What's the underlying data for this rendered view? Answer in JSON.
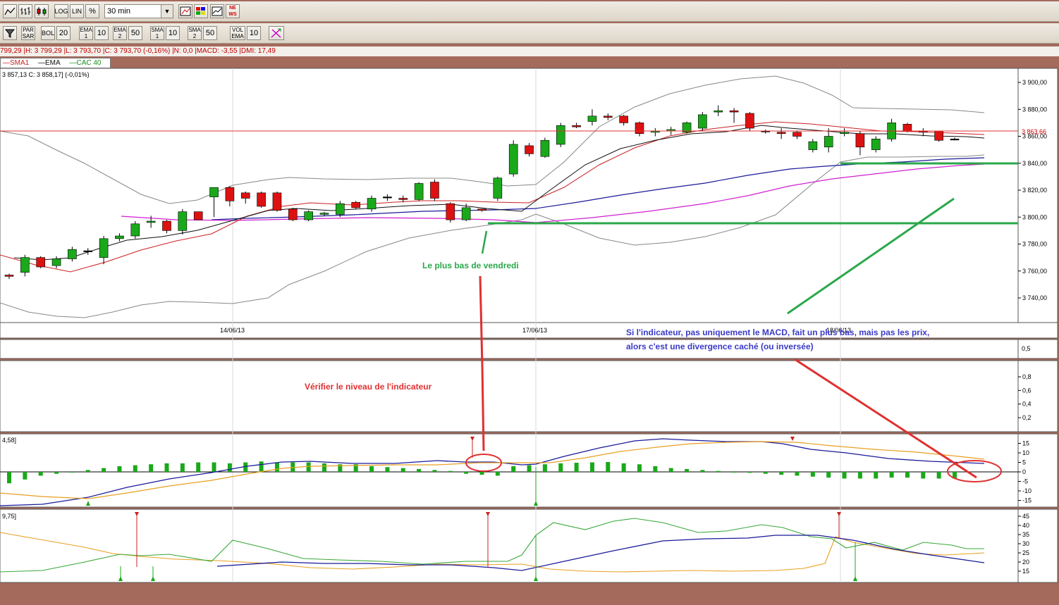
{
  "toolbar1": {
    "log_label": "LOG",
    "lin_label": "LIN",
    "percent_label": "%",
    "interval_value": "30 min",
    "news_label": "NE WS"
  },
  "toolbar2": {
    "par_sar_label": "PAR SAR",
    "bol_label": "BOL",
    "bol_period": "20",
    "ema1_label": "EMA 1",
    "ema1_period": "10",
    "ema2_label": "EMA 2",
    "ema2_period": "50",
    "sma1_label": "SMA 1",
    "sma1_period": "10",
    "sma2_label": "SMA 2",
    "sma2_period": "50",
    "vol_ema_label": "VOL EMA",
    "vol_ema_period": "10"
  },
  "info_line": "799,29 |H: 3 799,29 |L: 3 793,70 |C: 3 793,70 (-0,16%) |N: 0,0 |MACD: -3,55 |DMI: 17,49",
  "legend": {
    "sma1": "SMA1",
    "ema": "EMA",
    "cac": "CAC 40"
  },
  "price_header": "3 857,13 C: 3 858,17] (-0,01%)",
  "price_axis": [
    "3 900,00",
    "3 880,00",
    "3 860,00",
    "3 840,00",
    "3 820,00",
    "3 800,00",
    "3 780,00",
    "3 760,00",
    "3 740,00"
  ],
  "last_price_label": "3 863,66",
  "date_labels": [
    "14/06/13",
    "17/06/13",
    "18/06/13"
  ],
  "panel1_axis": [
    "0,5"
  ],
  "panel2_axis": [
    "0,8",
    "0,6",
    "0,4",
    "0,2"
  ],
  "macd_header": "4,58]",
  "macd_axis": [
    "15",
    "10",
    "5",
    "0",
    "-5",
    "-10",
    "-15"
  ],
  "dmi_header": "9,75]",
  "dmi_axis": [
    "45",
    "40",
    "35",
    "30",
    "25",
    "20",
    "15"
  ],
  "annotations": {
    "low_friday": "Le plus bas de vendredi",
    "check_level": "Vérifier le niveau de l'indicateur",
    "hidden_div_1": "Si l'indicateur, pas uniquement le MACD, fait un plus bas, mais pas les prix,",
    "hidden_div_2": "alors c'est une divergence caché (ou inversée)"
  },
  "colors": {
    "up": "#1aa91a",
    "down": "#dd1111",
    "annot_green": "#2aa84a",
    "annot_red": "#e03030",
    "annot_blue": "#3a3ac8",
    "sma_red": "#cc2020",
    "ema_black": "#111111",
    "mid_blue": "#1a1a9a",
    "ma_magenta": "#d020d0",
    "signal_orange": "#e8a020"
  },
  "candles": [
    {
      "o": 3757,
      "h": 3758,
      "l": 3754,
      "c": 3756
    },
    {
      "o": 3759,
      "h": 3772,
      "l": 3756,
      "c": 3770
    },
    {
      "o": 3770,
      "h": 3771,
      "l": 3762,
      "c": 3763
    },
    {
      "o": 3764,
      "h": 3771,
      "l": 3762,
      "c": 3769
    },
    {
      "o": 3769,
      "h": 3778,
      "l": 3767,
      "c": 3776
    },
    {
      "o": 3775,
      "h": 3777,
      "l": 3772,
      "c": 3775
    },
    {
      "o": 3770,
      "h": 3786,
      "l": 3765,
      "c": 3784
    },
    {
      "o": 3784,
      "h": 3788,
      "l": 3782,
      "c": 3786
    },
    {
      "o": 3786,
      "h": 3797,
      "l": 3784,
      "c": 3795
    },
    {
      "o": 3796,
      "h": 3801,
      "l": 3792,
      "c": 3797
    },
    {
      "o": 3797,
      "h": 3798,
      "l": 3788,
      "c": 3790
    },
    {
      "o": 3790,
      "h": 3806,
      "l": 3787,
      "c": 3804
    },
    {
      "o": 3804,
      "h": 3804,
      "l": 3798,
      "c": 3798
    },
    {
      "o": 3815,
      "h": 3822,
      "l": 3800,
      "c": 3822
    },
    {
      "o": 3822,
      "h": 3823,
      "l": 3808,
      "c": 3812
    },
    {
      "o": 3818,
      "h": 3819,
      "l": 3810,
      "c": 3814
    },
    {
      "o": 3818,
      "h": 3819,
      "l": 3807,
      "c": 3808
    },
    {
      "o": 3818,
      "h": 3819,
      "l": 3804,
      "c": 3805
    },
    {
      "o": 3806,
      "h": 3807,
      "l": 3797,
      "c": 3798
    },
    {
      "o": 3798,
      "h": 3805,
      "l": 3797,
      "c": 3804
    },
    {
      "o": 3802,
      "h": 3804,
      "l": 3801,
      "c": 3803
    },
    {
      "o": 3802,
      "h": 3812,
      "l": 3800,
      "c": 3810
    },
    {
      "o": 3811,
      "h": 3812,
      "l": 3806,
      "c": 3807
    },
    {
      "o": 3806,
      "h": 3816,
      "l": 3804,
      "c": 3814
    },
    {
      "o": 3815,
      "h": 3817,
      "l": 3812,
      "c": 3815
    },
    {
      "o": 3814,
      "h": 3816,
      "l": 3811,
      "c": 3813
    },
    {
      "o": 3813,
      "h": 3826,
      "l": 3812,
      "c": 3825
    },
    {
      "o": 3826,
      "h": 3828,
      "l": 3812,
      "c": 3814
    },
    {
      "o": 3810,
      "h": 3811,
      "l": 3796,
      "c": 3798
    },
    {
      "o": 3798,
      "h": 3810,
      "l": 3797,
      "c": 3807
    },
    {
      "o": 3806,
      "h": 3806,
      "l": 3804,
      "c": 3805
    },
    {
      "o": 3814,
      "h": 3830,
      "l": 3812,
      "c": 3829
    },
    {
      "o": 3832,
      "h": 3857,
      "l": 3830,
      "c": 3854
    },
    {
      "o": 3853,
      "h": 3855,
      "l": 3845,
      "c": 3847
    },
    {
      "o": 3845,
      "h": 3859,
      "l": 3844,
      "c": 3857
    },
    {
      "o": 3854,
      "h": 3870,
      "l": 3852,
      "c": 3868
    },
    {
      "o": 3868,
      "h": 3870,
      "l": 3866,
      "c": 3867
    },
    {
      "o": 3871,
      "h": 3880,
      "l": 3868,
      "c": 3875
    },
    {
      "o": 3875,
      "h": 3877,
      "l": 3872,
      "c": 3874
    },
    {
      "o": 3875,
      "h": 3876,
      "l": 3868,
      "c": 3870
    },
    {
      "o": 3870,
      "h": 3871,
      "l": 3860,
      "c": 3862
    },
    {
      "o": 3863,
      "h": 3866,
      "l": 3860,
      "c": 3864
    },
    {
      "o": 3864,
      "h": 3867,
      "l": 3861,
      "c": 3865
    },
    {
      "o": 3863,
      "h": 3871,
      "l": 3862,
      "c": 3870
    },
    {
      "o": 3866,
      "h": 3878,
      "l": 3864,
      "c": 3876
    },
    {
      "o": 3878,
      "h": 3883,
      "l": 3875,
      "c": 3879
    },
    {
      "o": 3879,
      "h": 3881,
      "l": 3870,
      "c": 3878
    },
    {
      "o": 3877,
      "h": 3878,
      "l": 3864,
      "c": 3866
    },
    {
      "o": 3864,
      "h": 3865,
      "l": 3862,
      "c": 3864
    },
    {
      "o": 3863,
      "h": 3866,
      "l": 3858,
      "c": 3862
    },
    {
      "o": 3863,
      "h": 3864,
      "l": 3858,
      "c": 3860
    },
    {
      "o": 3850,
      "h": 3858,
      "l": 3848,
      "c": 3856
    },
    {
      "o": 3852,
      "h": 3866,
      "l": 3848,
      "c": 3860
    },
    {
      "o": 3862,
      "h": 3866,
      "l": 3860,
      "c": 3863
    },
    {
      "o": 3862,
      "h": 3864,
      "l": 3846,
      "c": 3852
    },
    {
      "o": 3850,
      "h": 3860,
      "l": 3848,
      "c": 3858
    },
    {
      "o": 3858,
      "h": 3873,
      "l": 3856,
      "c": 3870
    },
    {
      "o": 3869,
      "h": 3870,
      "l": 3863,
      "c": 3864
    },
    {
      "o": 3864,
      "h": 3866,
      "l": 3860,
      "c": 3863
    },
    {
      "o": 3864,
      "h": 3864,
      "l": 3856,
      "c": 3857
    },
    {
      "o": 3858,
      "h": 3859,
      "l": 3857,
      "c": 3858
    }
  ],
  "macd_hist": [
    -6,
    -4,
    -2,
    -1,
    0,
    1,
    2,
    3,
    3.5,
    4,
    4.5,
    4.5,
    5,
    5,
    4.5,
    5,
    5.5,
    5,
    5,
    5,
    4.5,
    4,
    4,
    3,
    2.5,
    2,
    1.5,
    1,
    0.5,
    -1,
    -1.5,
    -2,
    3,
    3.5,
    4,
    4.5,
    4.8,
    5,
    5.2,
    4.5,
    4,
    3,
    2,
    1.5,
    1,
    0.5,
    0,
    -0.5,
    -1,
    -1.5,
    -2,
    -2.5,
    -3,
    -3.5,
    -3.5,
    -3.5,
    -3,
    -3,
    -3.5,
    -3.5,
    -3.5
  ]
}
